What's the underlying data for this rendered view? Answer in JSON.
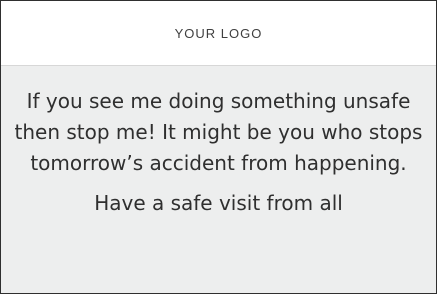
{
  "header": {
    "logo_text": "YOUR LOGO"
  },
  "content": {
    "message": "If you see me doing something unsafe then stop me! It might be you who stops tomorrow’s accident from happening.",
    "sign_off": "Have a safe visit from all"
  },
  "colors": {
    "header_background": "#ffffff",
    "content_background": "#edeeee",
    "text": "#2f2f2f",
    "border": "#2f2f2f"
  }
}
